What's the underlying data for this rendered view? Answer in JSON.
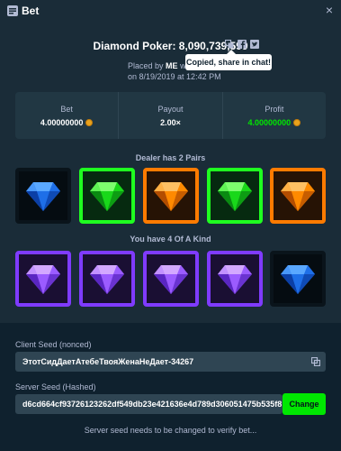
{
  "window": {
    "title": "Bet",
    "close_label": "×"
  },
  "game": {
    "title": "Diamond Poker: 8,090,739,599",
    "placed_by_prefix": "Placed by",
    "user": "ME",
    "placed_by_suffix": "w",
    "placed_on": "on 8/19/2019 at 12:42 PM",
    "tooltip": "Copied, share in chat!"
  },
  "stats": [
    {
      "label": "Bet",
      "value": "4.00000000",
      "coin": true
    },
    {
      "label": "Payout",
      "value": "2.00×",
      "coin": false
    },
    {
      "label": "Profit",
      "value": "4.00000000",
      "coin": true
    }
  ],
  "dealer": {
    "label": "Dealer has 2 Pairs",
    "cards": [
      {
        "gem": "blue",
        "frame": "plain"
      },
      {
        "gem": "green",
        "frame": "green"
      },
      {
        "gem": "orange",
        "frame": "orange"
      },
      {
        "gem": "green",
        "frame": "green"
      },
      {
        "gem": "orange",
        "frame": "orange"
      }
    ]
  },
  "player": {
    "label": "You have 4 Of A Kind",
    "cards": [
      {
        "gem": "purple",
        "frame": "purple"
      },
      {
        "gem": "purple",
        "frame": "purple"
      },
      {
        "gem": "purple",
        "frame": "purple"
      },
      {
        "gem": "purple",
        "frame": "purple"
      },
      {
        "gem": "blue",
        "frame": "plain"
      }
    ]
  },
  "seeds": {
    "client_label": "Client Seed (nonced)",
    "client_value": "ЭтотСидДаетАтебеТвояЖенаНеДает-34267",
    "server_label": "Server Seed (Hashed)",
    "server_value": "d6cd664cf93726123262df549db23e421636e4d789d306051475b535f8",
    "change_label": "Change",
    "note": "Server seed needs to be changed to verify bet..."
  },
  "colors": {
    "background": "#1a2c38",
    "panel": "#213743",
    "accent_green": "#00e701",
    "gem_blue": "#1e6fe8",
    "gem_green": "#19d81a",
    "gem_orange": "#ff8a00",
    "gem_purple": "#9b5cff"
  }
}
